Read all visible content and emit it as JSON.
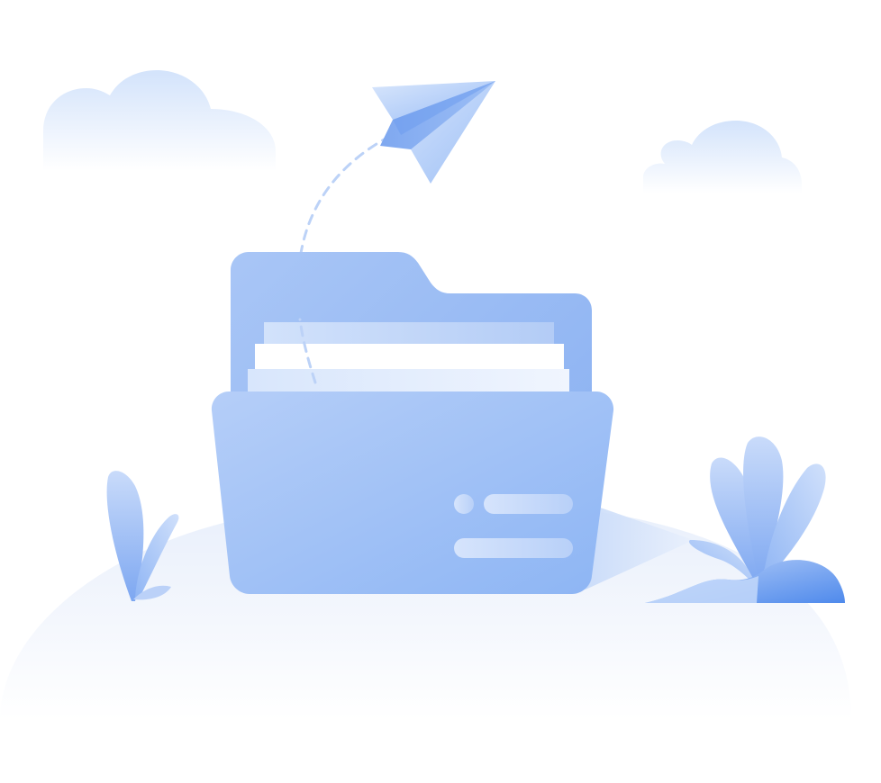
{
  "illustration": {
    "subject": "empty-folder",
    "colors": {
      "primary": "#8FB6F5",
      "primary_dark": "#5B93EE",
      "primary_light": "#C6DBFA",
      "paper": "#FFFFFF",
      "ground": "#EEF3FC",
      "cloud": "#DCE8FB",
      "trail": "#B9CFF5"
    }
  }
}
